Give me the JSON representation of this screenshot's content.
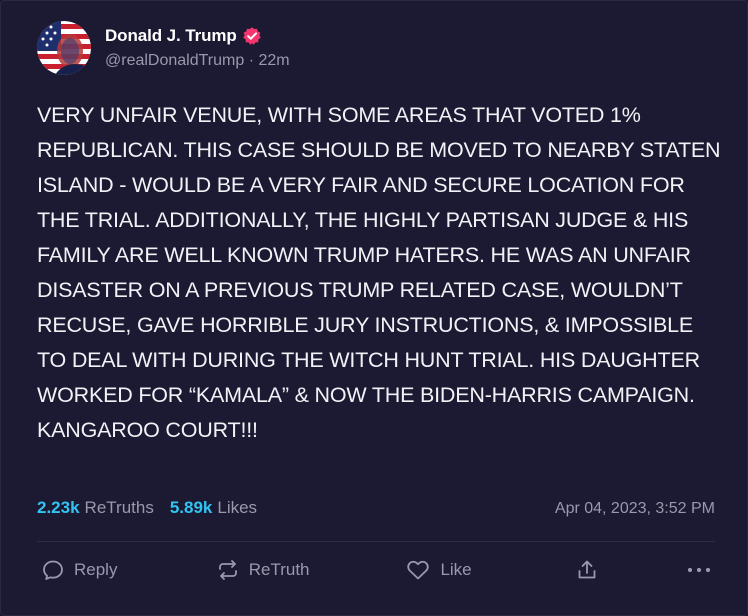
{
  "post": {
    "author": {
      "display_name": "Donald J. Trump",
      "handle": "@realDonaldTrump",
      "separator": "·",
      "relative_time": "22m",
      "verified": true,
      "verified_icon": "verified-badge-icon",
      "verified_color": "#f4356e"
    },
    "text": "VERY UNFAIR VENUE, WITH SOME AREAS THAT VOTED 1% REPUBLICAN. THIS CASE SHOULD BE MOVED TO NEARBY STATEN ISLAND - WOULD BE A VERY FAIR AND SECURE LOCATION FOR THE TRIAL. ADDITIONALLY, THE HIGHLY PARTISAN JUDGE & HIS FAMILY ARE WELL KNOWN TRUMP HATERS. HE WAS AN UNFAIR DISASTER ON A PREVIOUS TRUMP RELATED CASE, WOULDN’T RECUSE, GAVE HORRIBLE JURY INSTRUCTIONS, & IMPOSSIBLE TO DEAL WITH DURING THE WITCH HUNT TRIAL. HIS DAUGHTER WORKED FOR “KAMALA” & NOW THE BIDEN-HARRIS CAMPAIGN. KANGAROO COURT!!!",
    "stats": {
      "retruths_count": "2.23k",
      "retruths_label": "ReTruths",
      "likes_count": "5.89k",
      "likes_label": "Likes"
    },
    "timestamp": "Apr 04, 2023, 3:52 PM"
  },
  "actions": {
    "reply_label": "Reply",
    "retruth_label": "ReTruth",
    "like_label": "Like",
    "share_icon": "share-icon",
    "more_icon": "more-options-icon"
  },
  "colors": {
    "background": "#1c1a33",
    "accent_count": "#32c3f0",
    "muted_text": "#9a98ad"
  }
}
